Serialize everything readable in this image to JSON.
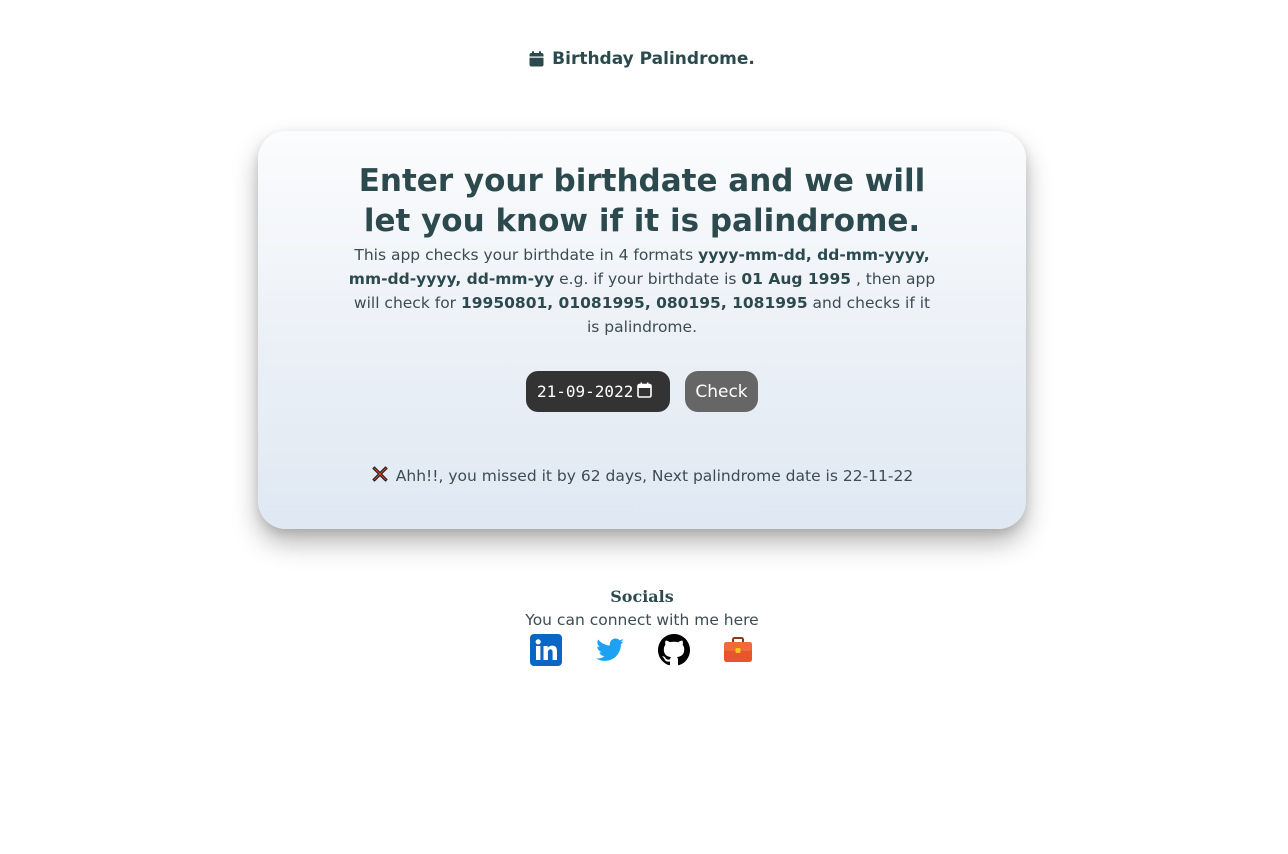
{
  "header": {
    "icon": "calendar-icon",
    "title": "Birthday Palindrome."
  },
  "card": {
    "headline": "Enter your birthdate and we will let you know if it is palindrome.",
    "description": {
      "part1": "This app checks your birthdate in 4 formats ",
      "formats": "yyyy-mm-dd, dd-mm-yyyy, mm-dd-yyyy, dd-mm-yy",
      "part2": "  e.g. if your birthdate is ",
      "example_date": "01 Aug 1995",
      "part3": " , then app will check for ",
      "example_values": "19950801, 01081995, 080195, 1081995",
      "part4": " and checks if it is palindrome."
    },
    "date_input": {
      "value": "21-09-2022",
      "icon": "calendar-icon"
    },
    "check_button": {
      "label": "Check",
      "color": "#666666"
    },
    "result": {
      "icon": "cross-mark-icon",
      "text": "Ahh!!, you missed it by 62 days, Next palindrome date is 22-11-22"
    }
  },
  "socials": {
    "title": "Socials",
    "subtitle": "You can connect with me here",
    "links": [
      {
        "icon": "linkedin-icon",
        "color": "#0a66c2"
      },
      {
        "icon": "twitter-icon",
        "color": "#1da1f2"
      },
      {
        "icon": "github-icon",
        "color": "#000000"
      },
      {
        "icon": "portfolio-briefcase-icon",
        "color": "#e8542c"
      }
    ]
  },
  "colors": {
    "text_primary": "#2c4a4e",
    "input_bg": "#333333"
  }
}
